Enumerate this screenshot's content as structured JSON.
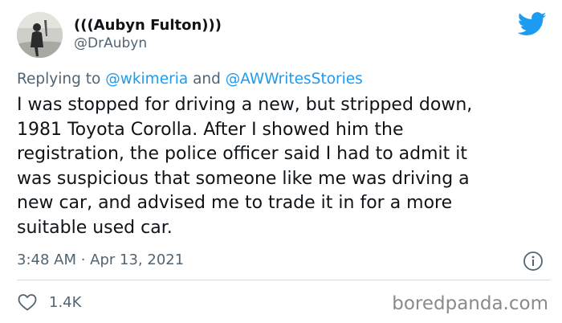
{
  "author": {
    "display_name": "(((Aubyn Fulton)))",
    "handle": "@DrAubyn",
    "avatar": "profile-photo-silhouette-icon"
  },
  "reply": {
    "prefix": "Replying to",
    "mention_1": "@wkimeria",
    "conjunction": "and",
    "mention_2": "@AWWritesStories"
  },
  "tweet": {
    "lines": [
      "I was stopped for driving a new, but stripped down,",
      "1981 Toyota Corolla. After I showed him the",
      "registration, the police officer said I had to admit it",
      "was suspicious that someone like me was driving a",
      "new car, and advised me to trade it in for a more",
      "suitable used car."
    ],
    "timestamp": "3:48 AM · Apr 13, 2021"
  },
  "engagement": {
    "like_count": "1.4K",
    "like_icon": "heart-icon",
    "info_icon": "info-icon"
  },
  "watermark": "boredpanda.com",
  "colors": {
    "text": "#0f1419",
    "secondary": "#536471",
    "link": "#1d9bf0",
    "twitter_blue": "#1d9bf0",
    "divider": "#cfd9de"
  }
}
